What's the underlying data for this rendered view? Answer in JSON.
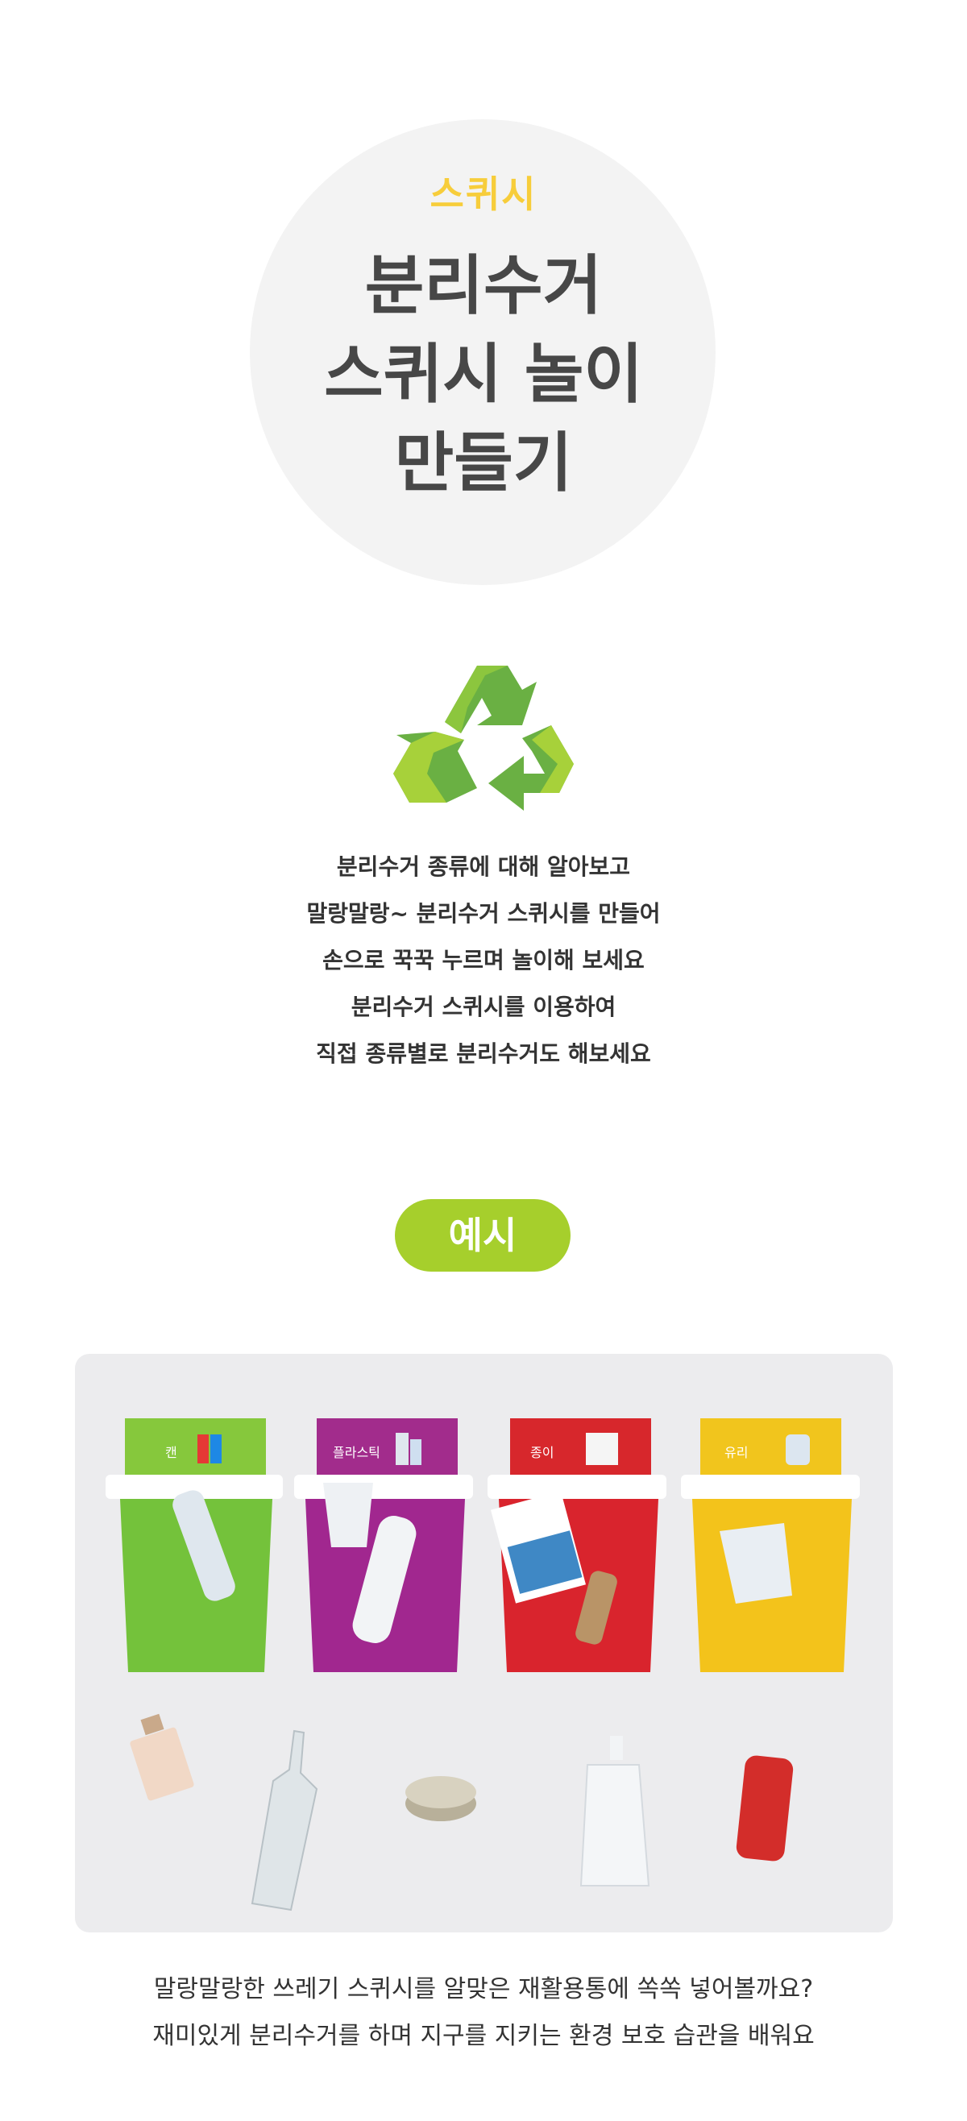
{
  "hero": {
    "subtitle": "스퀴시",
    "title_lines": [
      "분리수거",
      "스퀴시 놀이",
      "만들기"
    ]
  },
  "intro_lines": [
    "분리수거 종류에 대해 알아보고",
    "말랑말랑~ 분리수거 스퀴시를 만들어",
    "손으로 꾹꾹 누르며 놀이해 보세요",
    "분리수거 스퀴시를 이용하여",
    "직접 종류별로 분리수거도 해보세요"
  ],
  "example_label": "예시",
  "photo": {
    "bins": [
      {
        "label": "캔",
        "color": "#74c23b",
        "header": "#86c83c"
      },
      {
        "label": "플라스틱",
        "color": "#a1278f",
        "header": "#a22c8c"
      },
      {
        "label": "종이",
        "color": "#d9242d",
        "header": "#d7272c"
      },
      {
        "label": "유리",
        "color": "#f3c31b",
        "header": "#f1c51d"
      }
    ]
  },
  "bottom_lines": [
    "말랑말랑한 쓰레기 스퀴시를 알맞은 재활용통에 쏙쏙 넣어볼까요?",
    "재미있게 분리수거를 하며 지구를 지키는 환경 보호 습관을 배워요"
  ],
  "colors": {
    "accent_yellow": "#f7cd3b",
    "accent_green": "#a6cf2c",
    "title_gray": "#474747"
  }
}
